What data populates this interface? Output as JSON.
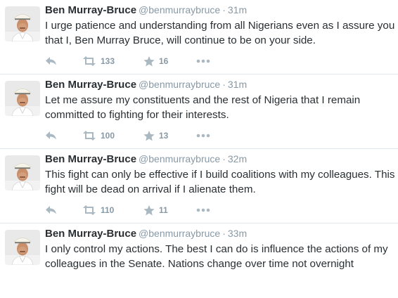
{
  "colors": {
    "name": "#292f33",
    "meta": "#8899a6",
    "icon": "#aab8c2",
    "divider": "#e1e8ed"
  },
  "icons": {
    "reply": "reply-icon",
    "retweet": "retweet-icon",
    "favorite": "star-icon",
    "more": "more-icon"
  },
  "tweets": [
    {
      "name": "Ben Murray-Bruce",
      "handle": "@benmurraybruce",
      "dot": "·",
      "time": "31m",
      "text": "I urge patience and understanding from all Nigerians even as I assure you that I, Ben Murray Bruce, will continue to be on your side.",
      "retweets": "133",
      "favorites": "16"
    },
    {
      "name": "Ben Murray-Bruce",
      "handle": "@benmurraybruce",
      "dot": "·",
      "time": "31m",
      "text": "Let me assure my constituents and the rest of Nigeria that I remain committed to fighting for their interests.",
      "retweets": "100",
      "favorites": "13"
    },
    {
      "name": "Ben Murray-Bruce",
      "handle": "@benmurraybruce",
      "dot": "·",
      "time": "32m",
      "text": "This fight can only be effective if I build coalitions with my colleagues. This fight will be dead on arrival if I alienate them.",
      "retweets": "110",
      "favorites": "11"
    },
    {
      "name": "Ben Murray-Bruce",
      "handle": "@benmurraybruce",
      "dot": "·",
      "time": "33m",
      "text": "I only control my actions. The best I can do is influence the actions of my colleagues in the Senate. Nations change over time not overnight",
      "retweets": "",
      "favorites": ""
    }
  ]
}
